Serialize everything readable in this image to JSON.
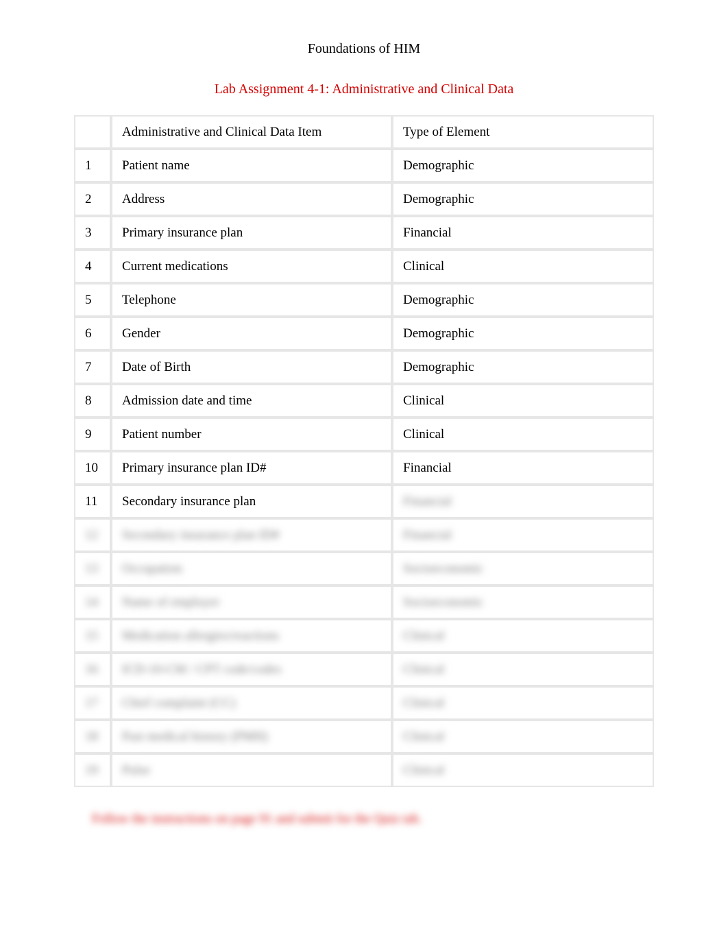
{
  "header": {
    "course_title": "Foundations of HIM",
    "assignment_title": "Lab Assignment 4-1: Administrative and Clinical Data"
  },
  "table": {
    "headers": {
      "num": "",
      "item": "Administrative and Clinical Data Item",
      "type": "Type of Element"
    },
    "rows": [
      {
        "num": "1",
        "item": "Patient name",
        "type": "Demographic",
        "blurred": false
      },
      {
        "num": "2",
        "item": "Address",
        "type": "Demographic",
        "blurred": false
      },
      {
        "num": "3",
        "item": "Primary insurance plan",
        "type": "Financial",
        "blurred": false
      },
      {
        "num": "4",
        "item": "Current medications",
        "type": "Clinical",
        "blurred": false
      },
      {
        "num": "5",
        "item": "Telephone",
        "type": "Demographic",
        "blurred": false
      },
      {
        "num": "6",
        "item": "Gender",
        "type": "Demographic",
        "blurred": false
      },
      {
        "num": "7",
        "item": "Date of Birth",
        "type": "Demographic",
        "blurred": false
      },
      {
        "num": "8",
        "item": "Admission date and time",
        "type": "Clinical",
        "blurred": false
      },
      {
        "num": "9",
        "item": "Patient number",
        "type": "Clinical",
        "blurred": false
      },
      {
        "num": "10",
        "item": "Primary insurance plan ID#",
        "type": "Financial",
        "blurred": false
      },
      {
        "num": "11",
        "item": "Secondary insurance plan",
        "type": "Financial",
        "blurred": "type"
      },
      {
        "num": "12",
        "item": "Secondary insurance plan ID#",
        "type": "Financial",
        "blurred": true
      },
      {
        "num": "13",
        "item": "Occupation",
        "type": "Socioeconomic",
        "blurred": true
      },
      {
        "num": "14",
        "item": "Name of employer",
        "type": "Socioeconomic",
        "blurred": true
      },
      {
        "num": "15",
        "item": "Medication allergies/reactions",
        "type": "Clinical",
        "blurred": true
      },
      {
        "num": "16",
        "item": "ICD-10-CM / CPT code/codes",
        "type": "Clinical",
        "blurred": true
      },
      {
        "num": "17",
        "item": "Chief complaint (CC)",
        "type": "Clinical",
        "blurred": true
      },
      {
        "num": "18",
        "item": "Past medical history (PMH)",
        "type": "Clinical",
        "blurred": true
      },
      {
        "num": "19",
        "item": "Pulse",
        "type": "Clinical",
        "blurred": true
      }
    ]
  },
  "footer": {
    "note": "Follow the instructions on page 91 and submit for the Quiz tab."
  }
}
